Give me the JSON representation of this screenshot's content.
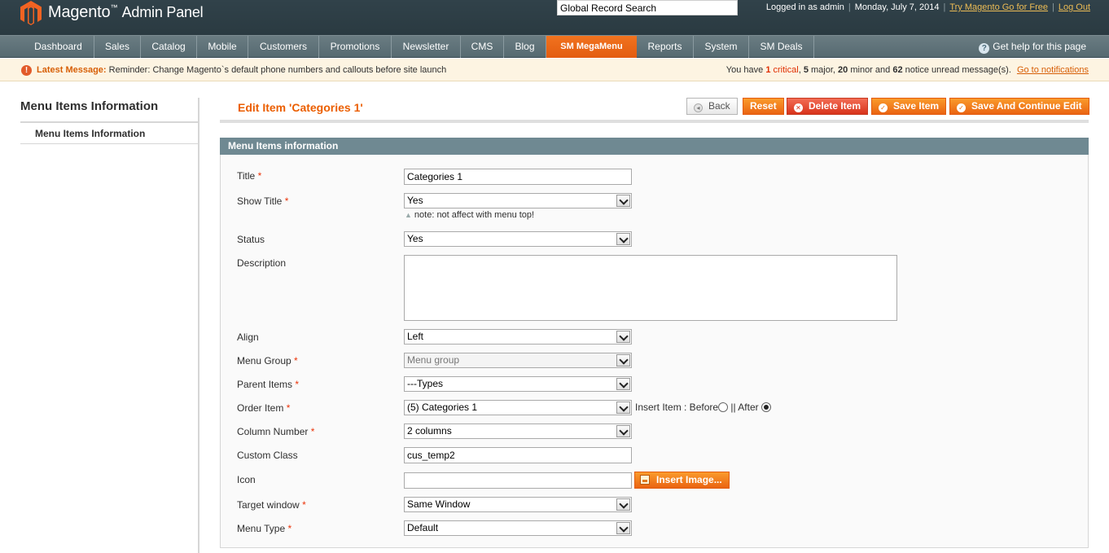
{
  "header": {
    "logo_text": "Magento",
    "logo_subtitle": "Admin Panel",
    "logo_tm": "™",
    "global_search_value": "Global Record Search",
    "logged_in": "Logged in as admin",
    "date": "Monday, July 7, 2014",
    "try_link": "Try Magento Go for Free",
    "logout_link": "Log Out"
  },
  "nav": {
    "items": [
      {
        "label": "Dashboard"
      },
      {
        "label": "Sales"
      },
      {
        "label": "Catalog"
      },
      {
        "label": "Mobile"
      },
      {
        "label": "Customers"
      },
      {
        "label": "Promotions"
      },
      {
        "label": "Newsletter"
      },
      {
        "label": "CMS"
      },
      {
        "label": "Blog"
      },
      {
        "label": "SM MegaMenu",
        "active": true
      },
      {
        "label": "Reports"
      },
      {
        "label": "System"
      },
      {
        "label": "SM Deals"
      }
    ],
    "help": "Get help for this page"
  },
  "message": {
    "latest_label": "Latest Message:",
    "latest_text": "Reminder: Change Magento`s default phone numbers and callouts before site launch",
    "prefix": "You have",
    "critical_count": "1",
    "critical_label": "critical",
    "major": "5 major,",
    "minor": "20 minor and",
    "notice": "62 notice unread message(s).",
    "major_count": "5",
    "major_label": "major,",
    "minor_count": "20",
    "minor_label": "minor and",
    "notice_count": "62",
    "notice_label": "notice unread message(s).",
    "link": "Go to notifications"
  },
  "sidebar": {
    "title": "Menu Items Information",
    "tabs": [
      {
        "label": "Menu Items Information"
      }
    ]
  },
  "page": {
    "title": "Edit Item 'Categories 1'",
    "buttons": {
      "back": "Back",
      "reset": "Reset",
      "delete": "Delete Item",
      "save": "Save Item",
      "save_continue": "Save And Continue Edit"
    }
  },
  "form": {
    "section_title": "Menu Items information",
    "fields": {
      "title": {
        "label": "Title",
        "value": "Categories 1",
        "required": true
      },
      "show_title": {
        "label": "Show Title",
        "value": "Yes",
        "required": true,
        "note": "note: not affect with menu top!"
      },
      "status": {
        "label": "Status",
        "value": "Yes"
      },
      "description": {
        "label": "Description",
        "value": ""
      },
      "align": {
        "label": "Align",
        "value": "Left"
      },
      "menu_group": {
        "label": "Menu Group",
        "value": "Menu group",
        "required": true
      },
      "parent_items": {
        "label": "Parent Items",
        "value": "---Types",
        "required": true
      },
      "order_item": {
        "label": "Order Item",
        "value": "(5) Categories 1",
        "required": true,
        "insert_label": "Insert Item : Before",
        "insert_after": "|| After",
        "selected": "After"
      },
      "column_number": {
        "label": "Column Number",
        "value": "2 columns",
        "required": true
      },
      "custom_class": {
        "label": "Custom Class",
        "value": "cus_temp2"
      },
      "icon": {
        "label": "Icon",
        "value": "",
        "button": "Insert Image..."
      },
      "target_window": {
        "label": "Target window",
        "value": "Same Window",
        "required": true
      },
      "menu_type": {
        "label": "Menu Type",
        "value": "Default",
        "required": true
      }
    },
    "required_mark": "*"
  },
  "colors": {
    "header_bg": "#2d3e45",
    "nav_bg": "#5f7278",
    "accent": "#eb5e00",
    "button": "#f18a20",
    "delete": "#e0472c",
    "section_head": "#6f8992"
  }
}
